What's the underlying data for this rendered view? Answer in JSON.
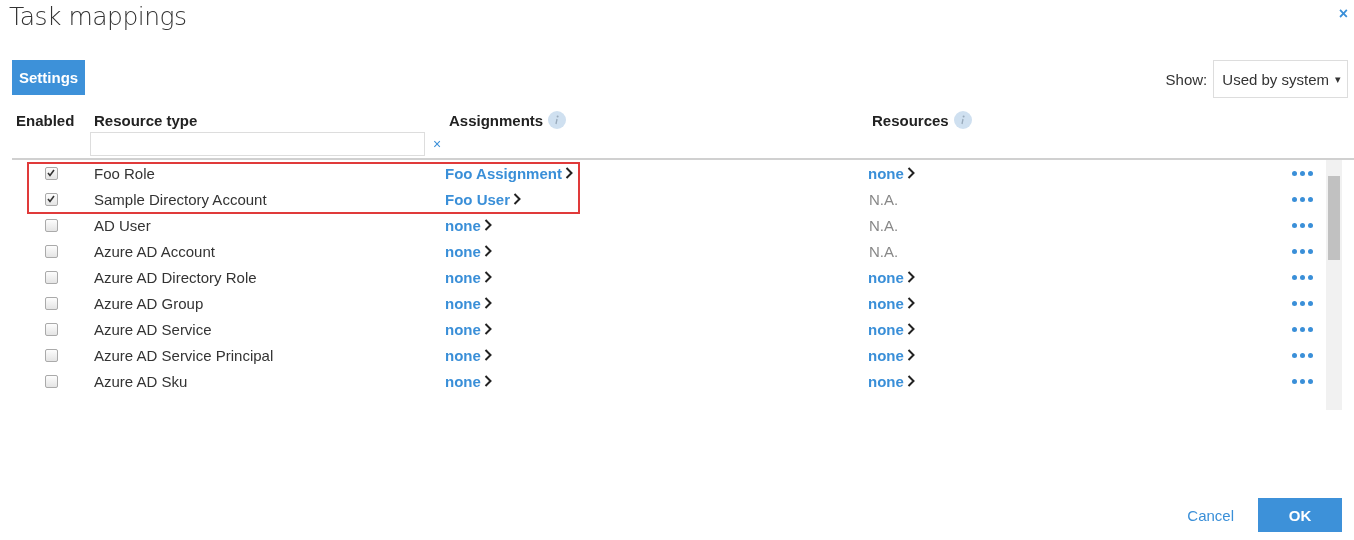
{
  "dialog": {
    "title": "Task mappings",
    "close": "×"
  },
  "toolbar": {
    "settings_button": "Settings",
    "show_label": "Show:",
    "show_value": "Used by system",
    "show_caret": "▾"
  },
  "table": {
    "columns": [
      {
        "label": "Enabled",
        "info": false
      },
      {
        "label": "Resource type",
        "info": false
      },
      {
        "label": "Assignments",
        "info": true
      },
      {
        "label": "Resources",
        "info": true
      }
    ],
    "filter": {
      "clear": "×"
    },
    "rows": [
      {
        "enabled": true,
        "highlighted": true,
        "name": "Foo Role",
        "assignment": "Foo Assignment",
        "resource": {
          "kind": "link",
          "text": "none"
        }
      },
      {
        "enabled": true,
        "highlighted": true,
        "name": "Sample Directory Account",
        "assignment": "Foo User",
        "resource": {
          "kind": "na",
          "text": "N.A."
        }
      },
      {
        "enabled": false,
        "highlighted": false,
        "name": "AD User",
        "assignment": "none",
        "resource": {
          "kind": "na",
          "text": "N.A."
        }
      },
      {
        "enabled": false,
        "highlighted": false,
        "name": "Azure AD Account",
        "assignment": "none",
        "resource": {
          "kind": "na",
          "text": "N.A."
        }
      },
      {
        "enabled": false,
        "highlighted": false,
        "name": "Azure AD Directory Role",
        "assignment": "none",
        "resource": {
          "kind": "link",
          "text": "none"
        }
      },
      {
        "enabled": false,
        "highlighted": false,
        "name": "Azure AD Group",
        "assignment": "none",
        "resource": {
          "kind": "link",
          "text": "none"
        }
      },
      {
        "enabled": false,
        "highlighted": false,
        "name": "Azure AD Service",
        "assignment": "none",
        "resource": {
          "kind": "link",
          "text": "none"
        }
      },
      {
        "enabled": false,
        "highlighted": false,
        "name": "Azure AD Service Principal",
        "assignment": "none",
        "resource": {
          "kind": "link",
          "text": "none"
        }
      },
      {
        "enabled": false,
        "highlighted": false,
        "name": "Azure AD Sku",
        "assignment": "none",
        "resource": {
          "kind": "link",
          "text": "none"
        }
      }
    ]
  },
  "footer": {
    "cancel": "Cancel",
    "ok": "OK"
  }
}
